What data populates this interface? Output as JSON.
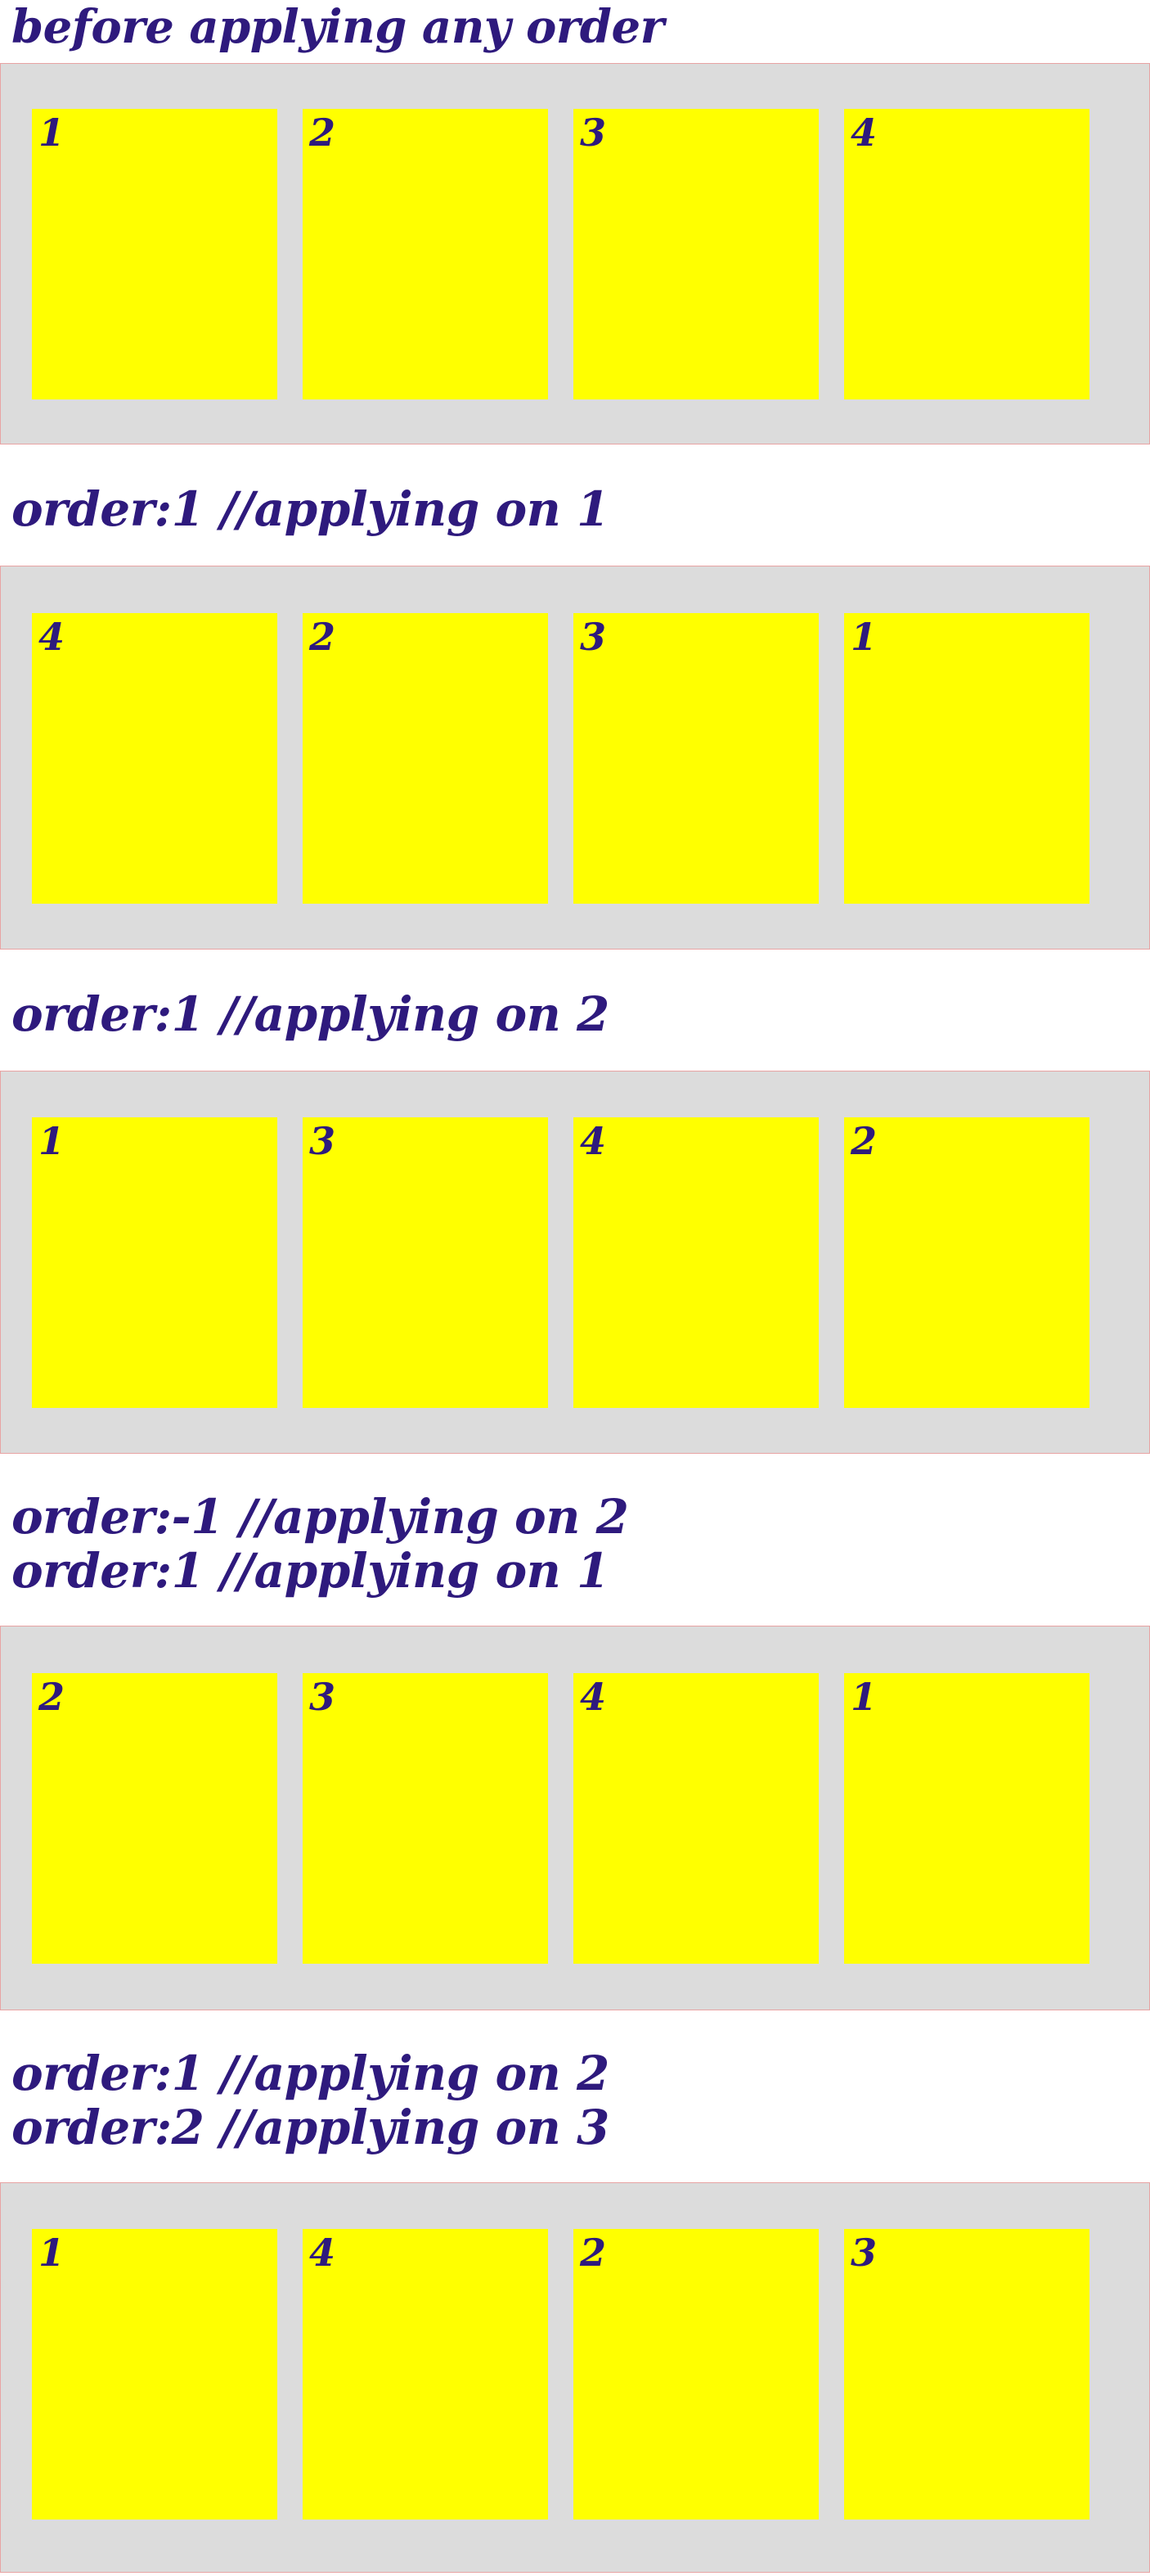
{
  "theme": {
    "text_color": "#2e1a7d",
    "container_background": "#dcdcdc",
    "container_border": "#e8a3a3",
    "item_background": "#ffff00",
    "page_background": "#ffffff"
  },
  "sections": [
    {
      "captions": [
        "before applying any order"
      ],
      "items": [
        {
          "label": "1"
        },
        {
          "label": "2"
        },
        {
          "label": "3"
        },
        {
          "label": "4"
        }
      ]
    },
    {
      "captions": [
        "order:1 //applying on 1"
      ],
      "items": [
        {
          "label": "4"
        },
        {
          "label": "2"
        },
        {
          "label": "3"
        },
        {
          "label": "1"
        }
      ]
    },
    {
      "captions": [
        "order:1 //applying on 2"
      ],
      "items": [
        {
          "label": "1"
        },
        {
          "label": "3"
        },
        {
          "label": "4"
        },
        {
          "label": "2"
        }
      ]
    },
    {
      "captions": [
        "order:-1 //applying on 2",
        "order:1 //applying on 1"
      ],
      "items": [
        {
          "label": "2"
        },
        {
          "label": "3"
        },
        {
          "label": "4"
        },
        {
          "label": "1"
        }
      ]
    },
    {
      "captions": [
        "order:1 //applying on 2",
        "order:2 //applying on 3"
      ],
      "items": [
        {
          "label": "1"
        },
        {
          "label": "4"
        },
        {
          "label": "2"
        },
        {
          "label": "3"
        }
      ]
    }
  ]
}
